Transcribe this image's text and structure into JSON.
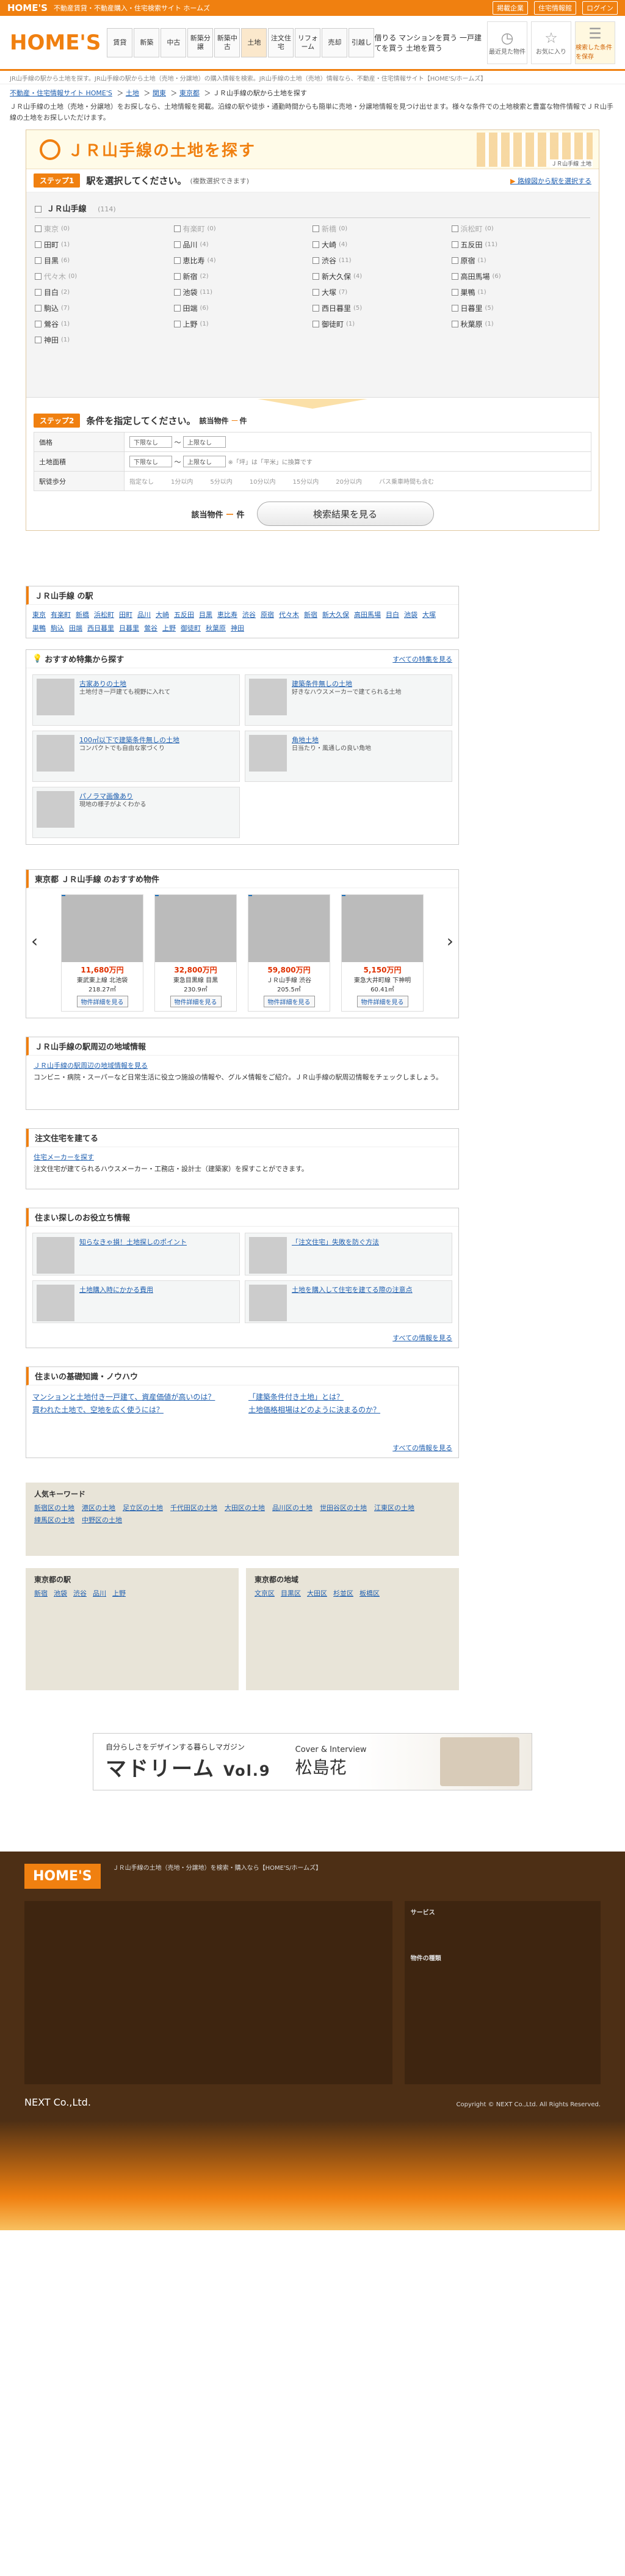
{
  "topbar": {
    "logo": "HOME'S",
    "tagline": "不動産賃貸・不動産購入・住宅検索サイト ホームズ",
    "links": [
      "掲載企業",
      "住宅情報館",
      "ログイン"
    ]
  },
  "header": {
    "brand": "HOME'S",
    "tiny": [
      "借りる",
      "マンションを買う",
      "一戸建てを買う",
      "土地を買う"
    ],
    "nav": [
      "賃貸",
      "新築",
      "中古",
      "新築分譲",
      "新築中古",
      "土地",
      "注文住宅",
      "リフォーム",
      "売却",
      "引越し"
    ],
    "icons": [
      {
        "icon": "clock-icon",
        "label": "最近見た物件"
      },
      {
        "icon": "star-icon",
        "label": "お気に入り"
      },
      {
        "icon": "list-icon",
        "label": "検索した条件を保存"
      }
    ]
  },
  "crumbs_top": "JR山手線の駅から土地を探す。JR山手線の駅から土地（売地・分譲地）の購入情報を検索。JR山手線の土地（売地）情報なら、不動産・住宅情報サイト【HOME'S/ホームズ】",
  "crumbs": [
    "不動産・住宅情報サイト HOME'S",
    "土地",
    "関東",
    "東京都",
    "ＪＲ山手線の駅から土地を探す"
  ],
  "intro": "ＪＲ山手線の土地（売地・分譲地）をお探しなら、土地情報を掲載。沿線の駅や徒歩・通勤時間からも簡単に売地・分譲地情報を見つけ出せます。様々な条件での土地検索と豊富な物件情報でＪＲ山手線の土地をお探しいただけます。",
  "main": {
    "title": "ＪＲ山手線の土地を探す",
    "pic_caption": "ＪＲ山手線 土地",
    "step1": {
      "badge": "ステップ1",
      "text": "駅を選択してください。",
      "note": "(複数選択できます)",
      "link": "路線図から駅を選択する"
    },
    "line": {
      "name": "ＪＲ山手線",
      "count": "(114)"
    },
    "stations": [
      {
        "n": "東京",
        "c": "(0)",
        "d": true
      },
      {
        "n": "有楽町",
        "c": "(0)",
        "d": true
      },
      {
        "n": "新橋",
        "c": "(0)",
        "d": true
      },
      {
        "n": "浜松町",
        "c": "(0)",
        "d": true
      },
      {
        "n": "田町",
        "c": "(1)"
      },
      {
        "n": "品川",
        "c": "(4)"
      },
      {
        "n": "大崎",
        "c": "(4)"
      },
      {
        "n": "五反田",
        "c": "(11)"
      },
      {
        "n": "目黒",
        "c": "(6)"
      },
      {
        "n": "恵比寿",
        "c": "(4)"
      },
      {
        "n": "渋谷",
        "c": "(11)"
      },
      {
        "n": "原宿",
        "c": "(1)"
      },
      {
        "n": "代々木",
        "c": "(0)",
        "d": true
      },
      {
        "n": "新宿",
        "c": "(2)"
      },
      {
        "n": "新大久保",
        "c": "(4)"
      },
      {
        "n": "高田馬場",
        "c": "(6)"
      },
      {
        "n": "目白",
        "c": "(2)"
      },
      {
        "n": "池袋",
        "c": "(11)"
      },
      {
        "n": "大塚",
        "c": "(7)"
      },
      {
        "n": "巣鴨",
        "c": "(1)"
      },
      {
        "n": "駒込",
        "c": "(7)"
      },
      {
        "n": "田端",
        "c": "(6)"
      },
      {
        "n": "西日暮里",
        "c": "(5)"
      },
      {
        "n": "日暮里",
        "c": "(5)"
      },
      {
        "n": "鶯谷",
        "c": "(1)"
      },
      {
        "n": "上野",
        "c": "(1)"
      },
      {
        "n": "御徒町",
        "c": "(1)"
      },
      {
        "n": "秋葉原",
        "c": "(1)"
      },
      {
        "n": "神田",
        "c": "(1)"
      }
    ],
    "step2": {
      "badge": "ステップ2",
      "text": "条件を指定してください。",
      "count_label": "該当物件",
      "count": "ー",
      "unit": "件"
    },
    "cond": [
      {
        "h": "価格",
        "v": [
          "下限なし",
          "〜",
          "上限なし"
        ]
      },
      {
        "h": "土地面積",
        "v": [
          "下限なし",
          "〜",
          "上限なし",
          "※「坪」は「平米」に換算です"
        ]
      },
      {
        "h": "駅徒歩分",
        "v": [
          "指定なし",
          "1分以内",
          "5分以内",
          "10分以内",
          "15分以内",
          "20分以内",
          "バス乗車時間も含む"
        ]
      }
    ],
    "result_label": "該当物件",
    "result_count": "ー",
    "result_unit": "件",
    "search_btn": "検索結果を見る"
  },
  "stations_section": {
    "title": "ＪＲ山手線 の駅",
    "links": [
      "東京",
      "有楽町",
      "新橋",
      "浜松町",
      "田町",
      "品川",
      "大崎",
      "五反田",
      "目黒",
      "恵比寿",
      "渋谷",
      "原宿",
      "代々木",
      "新宿",
      "新大久保",
      "高田馬場",
      "目白",
      "池袋",
      "大塚",
      "巣鴨",
      "駒込",
      "田端",
      "西日暮里",
      "日暮里",
      "鶯谷",
      "上野",
      "御徒町",
      "秋葉原",
      "神田"
    ]
  },
  "feature": {
    "title": "おすすめ特集から探す",
    "more": "すべての特集を見る",
    "cards": [
      {
        "t": "古家ありの土地",
        "d": "土地付き一戸建ても視野に入れて"
      },
      {
        "t": "建築条件無しの土地",
        "d": "好きなハウスメーカーで建てられる土地"
      },
      {
        "t": "100㎡以下で建築条件無しの土地",
        "d": "コンパクトでも自由な家づくり"
      },
      {
        "t": "角地土地",
        "d": "日当たり・風通しの良い角地"
      },
      {
        "t": "パノラマ画像あり",
        "d": "現地の様子がよくわかる"
      }
    ]
  },
  "recommend": {
    "title": "東京都 ＪＲ山手線 のおすすめ物件",
    "items": [
      {
        "price": "11,680万円",
        "name": "東武東上線 北池袋",
        "area": "218.27㎡",
        "btn": "物件詳細を見る"
      },
      {
        "price": "32,800万円",
        "name": "東急目黒線 目黒",
        "area": "230.9㎡",
        "btn": "物件詳細を見る"
      },
      {
        "price": "59,800万円",
        "name": "ＪＲ山手線 渋谷",
        "area": "205.5㎡",
        "btn": "物件詳細を見る"
      },
      {
        "price": "5,150万円",
        "name": "東急大井町線 下神明",
        "area": "60.41㎡",
        "btn": "物件詳細を見る"
      }
    ]
  },
  "info1": {
    "title": "ＪＲ山手線の駅周辺の地域情報",
    "link": "ＪＲ山手線の駅周辺の地域情報を見る",
    "text": "コンビニ・病院・スーパーなど日常生活に役立つ施設の情報や、グルメ情報をご紹介。ＪＲ山手線の駅周辺情報をチェックしましょう。"
  },
  "info2": {
    "title": "注文住宅を建てる",
    "link": "住宅メーカーを探す",
    "text": "注文住宅が建てられるハウスメーカー・工務店・設計士（建築家）を探すことができます。"
  },
  "tips": {
    "title": "住まい探しのお役立ち情報",
    "more": "すべての情報を見る",
    "items": [
      "知らなきゃ損！土地探しのポイント",
      "「注文住宅」失敗を防ぐ方法",
      "土地購入時にかかる費用",
      "土地を購入して住宅を建てる際の注意点"
    ]
  },
  "knowhow": {
    "title": "住まいの基礎知識・ノウハウ",
    "more": "すべての情報を見る",
    "items": [
      "マンションと土地付き一戸建て、資産価値が高いのは？",
      "「建築条件付き土地」とは？",
      "買われた土地で、空地を広く使うには？",
      "土地価格相場はどのように決まるのか？"
    ]
  },
  "keywords": {
    "title": "人気キーワード",
    "row": [
      "新宿区の土地",
      "港区の土地",
      "足立区の土地",
      "千代田区の土地",
      "大田区の土地",
      "品川区の土地",
      "世田谷区の土地",
      "江東区の土地",
      "練馬区の土地",
      "中野区の土地"
    ]
  },
  "sub": {
    "left": {
      "title": "東京都の駅",
      "items": [
        "新宿",
        "池袋",
        "渋谷",
        "品川",
        "上野"
      ]
    },
    "right": {
      "title": "東京都の地域",
      "items": [
        "文京区",
        "目黒区",
        "大田区",
        "杉並区",
        "板橋区"
      ]
    }
  },
  "banner": {
    "sub": "自分らしさをデザインする暮らしマガジン",
    "title": "マドリーム",
    "vol": "Vol.9",
    "cover": "Cover & Interview",
    "name": "松島花"
  },
  "footer": {
    "logo": "HOME'S",
    "about": "ＪＲ山手線の土地（売地・分譲地）を検索・購入なら【HOME'S/ホームズ】",
    "services": "サービス",
    "property": "物件の種類",
    "copyright": "Copyright © NEXT Co.,Ltd. All Rights Reserved.",
    "company": "NEXT Co.,Ltd."
  }
}
